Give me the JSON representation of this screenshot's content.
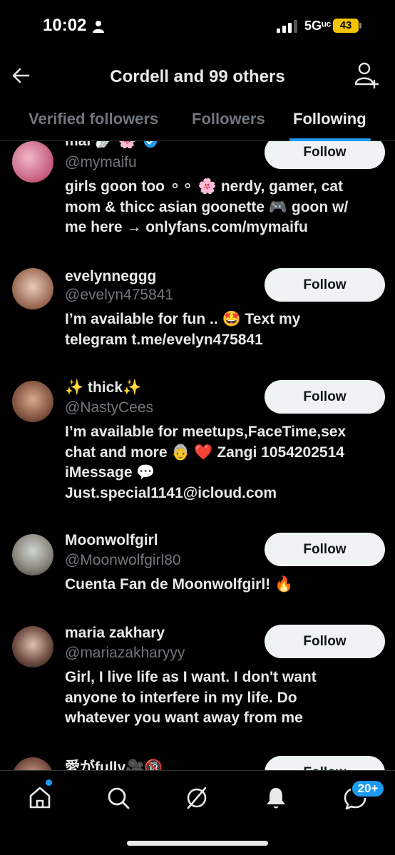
{
  "status_bar": {
    "time": "10:02",
    "network": "5Gᵘᶜ",
    "battery": "43"
  },
  "header": {
    "title": "Cordell and 99 others"
  },
  "tabs": [
    {
      "label": "Verified followers"
    },
    {
      "label": "Followers"
    },
    {
      "label": "Following",
      "active": true
    }
  ],
  "accounts": [
    {
      "name": "mai 🪽 🌸",
      "verified": true,
      "handle": "@mymaifu",
      "bio": [
        "girls goon too ⚬⚬ 🌸 nerdy, gamer, cat",
        "mom & thicc asian goonette 🎮 goon w/",
        "me here → onlyfans.com/mymaifu"
      ],
      "button": "Follow"
    },
    {
      "name": "evelynneggg",
      "handle": "@evelyn475841",
      "bio": [
        "I’m available for fun .. 🤩 Text my",
        "telegram t.me/evelyn475841"
      ],
      "button": "Follow"
    },
    {
      "name": "✨ thick✨",
      "handle": "@NastyCees",
      "bio": [
        "I’m available for meetups,FaceTime,sex",
        "chat and more 👵 ❤️ Zangi 1054202514",
        "iMessage 💬",
        "Just.special1141@icloud.com"
      ],
      "button": "Follow"
    },
    {
      "name": "Moonwolfgirl",
      "handle": "@Moonwolfgirl80",
      "bio": [
        "Cuenta Fan de Moonwolfgirl! 🔥"
      ],
      "button": "Follow"
    },
    {
      "name": "maria zakhary",
      "handle": "@mariazakharyyy",
      "bio": [
        "Girl, I live life as I want. I don't want",
        "anyone to interfere in my life. Do",
        "whatever you want away from me"
      ],
      "button": "Follow"
    },
    {
      "name": "愛がfully🎥🔞",
      "handle": "",
      "bio": [],
      "button": "Follow"
    }
  ],
  "bottom_nav": {
    "items": [
      "home-icon",
      "search-icon",
      "grok-icon",
      "notifications-icon",
      "messages-icon"
    ],
    "messages_badge": "20+"
  },
  "colors": {
    "accent": "#1d9bf0",
    "secondary_text": "#71767b",
    "button_bg": "#eff3f4"
  }
}
